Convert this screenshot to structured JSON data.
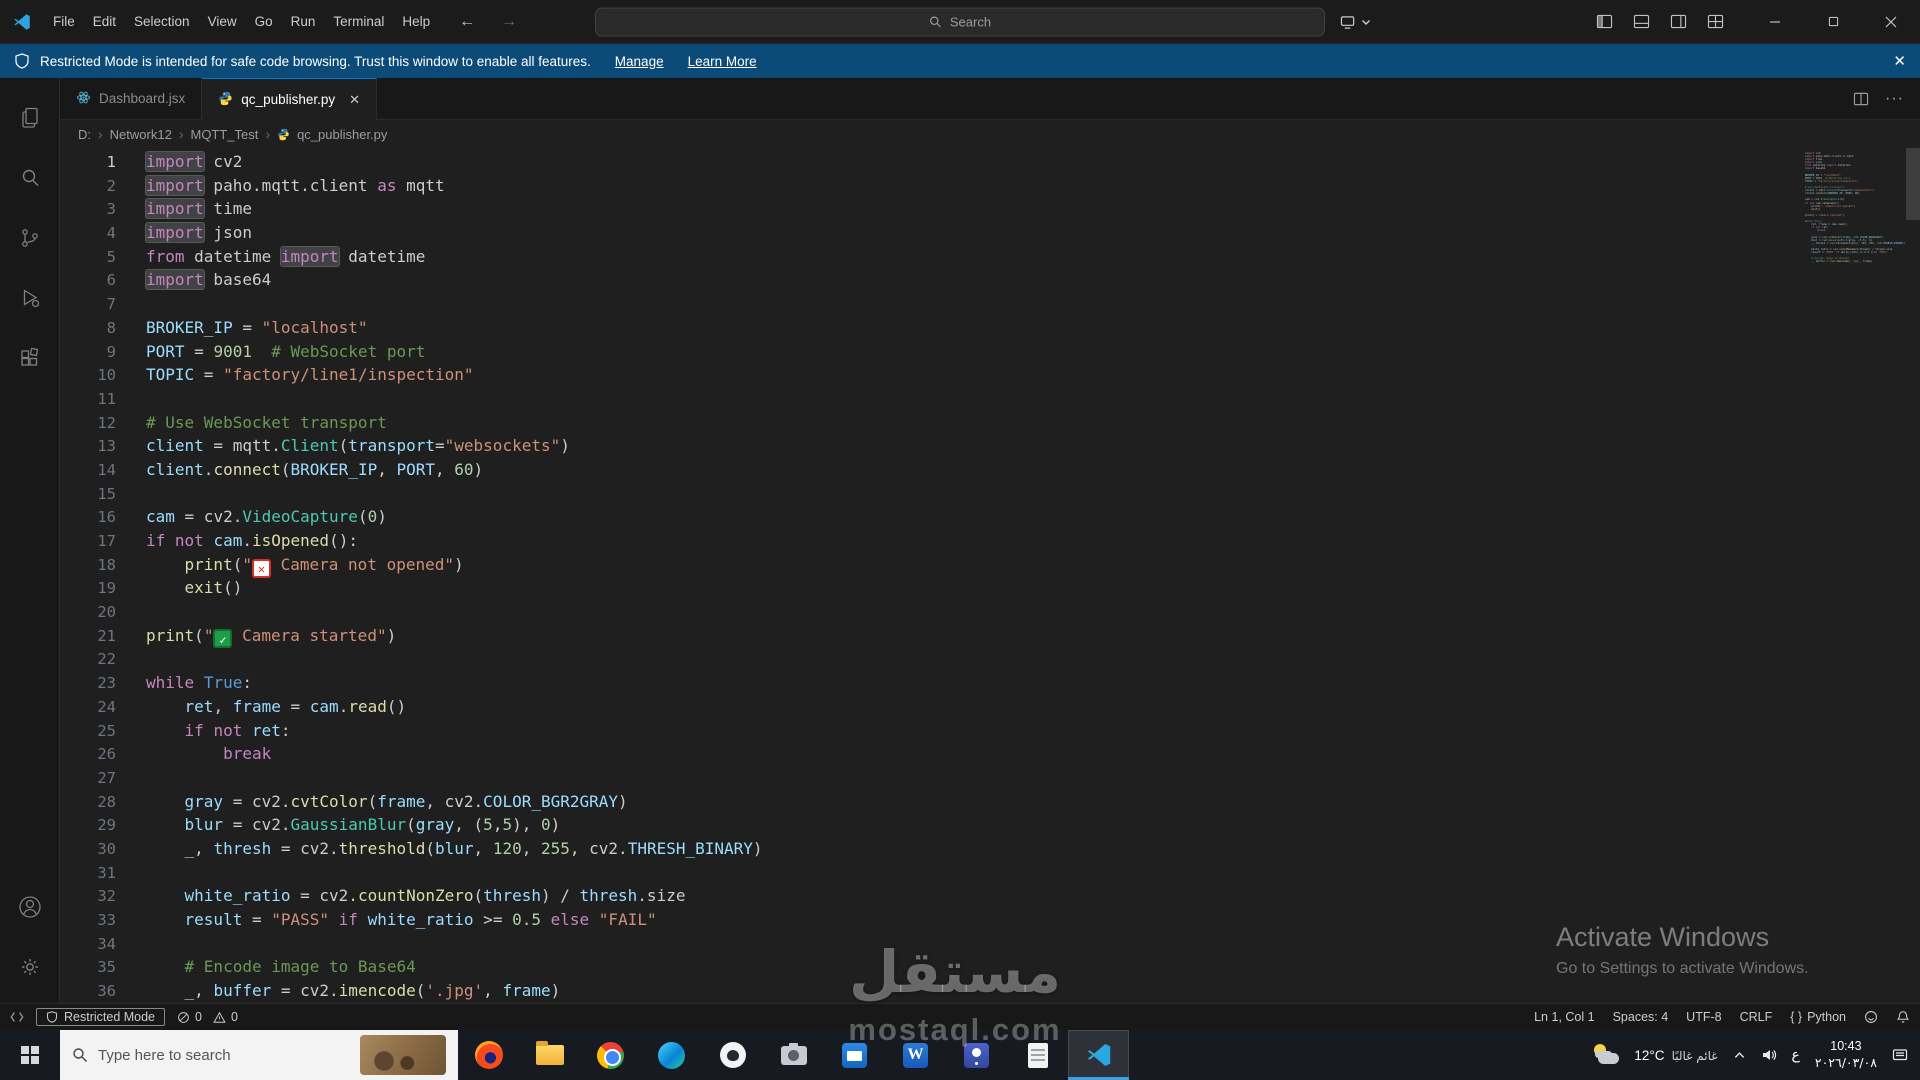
{
  "titlebar": {
    "menus": [
      "File",
      "Edit",
      "Selection",
      "View",
      "Go",
      "Run",
      "Terminal",
      "Help"
    ],
    "back_arrow": "←",
    "forward_arrow": "→",
    "search_placeholder": "Search"
  },
  "banner": {
    "text": "Restricted Mode is intended for safe code browsing. Trust this window to enable all features.",
    "manage_label": "Manage",
    "learn_more_label": "Learn More",
    "close_glyph": "✕"
  },
  "editor_tabs": [
    {
      "id": "dashboard",
      "label": "Dashboard.jsx",
      "icon": "react-icon",
      "active": false,
      "closable": false
    },
    {
      "id": "qc-publisher",
      "label": "qc_publisher.py",
      "icon": "python-icon",
      "active": true,
      "closable": true
    }
  ],
  "breadcrumbs": {
    "items": [
      "D:",
      "Network12",
      "MQTT_Test",
      "qc_publisher.py"
    ]
  },
  "editor": {
    "language": "python",
    "lines": [
      [
        [
          "khl",
          "import"
        ],
        [
          "d",
          " cv2"
        ]
      ],
      [
        [
          "khl",
          "import"
        ],
        [
          "d",
          " paho.mqtt.client "
        ],
        [
          "k",
          "as"
        ],
        [
          "d",
          " mqtt"
        ]
      ],
      [
        [
          "khl",
          "import"
        ],
        [
          "d",
          " time"
        ]
      ],
      [
        [
          "khl",
          "import"
        ],
        [
          "d",
          " json"
        ]
      ],
      [
        [
          "k",
          "from"
        ],
        [
          "d",
          " datetime "
        ],
        [
          "khl",
          "import"
        ],
        [
          "d",
          " datetime"
        ]
      ],
      [
        [
          "khl",
          "import"
        ],
        [
          "d",
          " base64"
        ]
      ],
      [],
      [
        [
          "v",
          "BROKER_IP"
        ],
        [
          "d",
          " = "
        ],
        [
          "s",
          "\"localhost\""
        ]
      ],
      [
        [
          "v",
          "PORT"
        ],
        [
          "d",
          " = "
        ],
        [
          "n",
          "9001"
        ],
        [
          "d",
          "  "
        ],
        [
          "c",
          "# WebSocket port"
        ]
      ],
      [
        [
          "v",
          "TOPIC"
        ],
        [
          "d",
          " = "
        ],
        [
          "s",
          "\"factory/line1/inspection\""
        ]
      ],
      [],
      [
        [
          "c",
          "# Use WebSocket transport"
        ]
      ],
      [
        [
          "v",
          "client"
        ],
        [
          "d",
          " = mqtt."
        ],
        [
          "t",
          "Client"
        ],
        [
          "d",
          "("
        ],
        [
          "pm",
          "transport"
        ],
        [
          "d",
          "="
        ],
        [
          "s",
          "\"websockets\""
        ],
        [
          "d",
          ")"
        ]
      ],
      [
        [
          "v",
          "client"
        ],
        [
          "d",
          "."
        ],
        [
          "f",
          "connect"
        ],
        [
          "d",
          "("
        ],
        [
          "v",
          "BROKER_IP"
        ],
        [
          "d",
          ", "
        ],
        [
          "v",
          "PORT"
        ],
        [
          "d",
          ", "
        ],
        [
          "n",
          "60"
        ],
        [
          "d",
          ")"
        ]
      ],
      [],
      [
        [
          "v",
          "cam"
        ],
        [
          "d",
          " = cv2."
        ],
        [
          "t",
          "VideoCapture"
        ],
        [
          "d",
          "("
        ],
        [
          "n",
          "0"
        ],
        [
          "d",
          ")"
        ]
      ],
      [
        [
          "k",
          "if"
        ],
        [
          "d",
          " "
        ],
        [
          "k",
          "not"
        ],
        [
          "d",
          " "
        ],
        [
          "v",
          "cam"
        ],
        [
          "d",
          "."
        ],
        [
          "f",
          "isOpened"
        ],
        [
          "d",
          "():"
        ]
      ],
      [
        [
          "d",
          "    "
        ],
        [
          "f",
          "print"
        ],
        [
          "d",
          "("
        ],
        [
          "s",
          "\""
        ],
        [
          "ex",
          "✕"
        ],
        [
          "s",
          " Camera not opened\""
        ],
        [
          "d",
          ")"
        ]
      ],
      [
        [
          "d",
          "    "
        ],
        [
          "f",
          "exit"
        ],
        [
          "d",
          "()"
        ]
      ],
      [],
      [
        [
          "f",
          "print"
        ],
        [
          "d",
          "("
        ],
        [
          "s",
          "\""
        ],
        [
          "chk",
          "✓"
        ],
        [
          "s",
          " Camera started\""
        ],
        [
          "d",
          ")"
        ]
      ],
      [],
      [
        [
          "k",
          "while"
        ],
        [
          "d",
          " "
        ],
        [
          "b",
          "True"
        ],
        [
          "d",
          ":"
        ]
      ],
      [
        [
          "d",
          "    "
        ],
        [
          "v",
          "ret"
        ],
        [
          "d",
          ", "
        ],
        [
          "v",
          "frame"
        ],
        [
          "d",
          " = "
        ],
        [
          "v",
          "cam"
        ],
        [
          "d",
          "."
        ],
        [
          "f",
          "read"
        ],
        [
          "d",
          "()"
        ]
      ],
      [
        [
          "d",
          "    "
        ],
        [
          "k",
          "if"
        ],
        [
          "d",
          " "
        ],
        [
          "k",
          "not"
        ],
        [
          "d",
          " "
        ],
        [
          "v",
          "ret"
        ],
        [
          "d",
          ":"
        ]
      ],
      [
        [
          "d",
          "        "
        ],
        [
          "k",
          "break"
        ]
      ],
      [],
      [
        [
          "d",
          "    "
        ],
        [
          "v",
          "gray"
        ],
        [
          "d",
          " = cv2."
        ],
        [
          "f",
          "cvtColor"
        ],
        [
          "d",
          "("
        ],
        [
          "v",
          "frame"
        ],
        [
          "d",
          ", cv2."
        ],
        [
          "v",
          "COLOR_BGR2GRAY"
        ],
        [
          "d",
          ")"
        ]
      ],
      [
        [
          "d",
          "    "
        ],
        [
          "v",
          "blur"
        ],
        [
          "d",
          " = cv2."
        ],
        [
          "t",
          "GaussianBlur"
        ],
        [
          "d",
          "("
        ],
        [
          "v",
          "gray"
        ],
        [
          "d",
          ", ("
        ],
        [
          "n",
          "5"
        ],
        [
          "d",
          ","
        ],
        [
          "n",
          "5"
        ],
        [
          "d",
          "), "
        ],
        [
          "n",
          "0"
        ],
        [
          "d",
          ")"
        ]
      ],
      [
        [
          "d",
          "    _, "
        ],
        [
          "v",
          "thresh"
        ],
        [
          "d",
          " = cv2."
        ],
        [
          "f",
          "threshold"
        ],
        [
          "d",
          "("
        ],
        [
          "v",
          "blur"
        ],
        [
          "d",
          ", "
        ],
        [
          "n",
          "120"
        ],
        [
          "d",
          ", "
        ],
        [
          "n",
          "255"
        ],
        [
          "d",
          ", cv2."
        ],
        [
          "v",
          "THRESH_BINARY"
        ],
        [
          "d",
          ")"
        ]
      ],
      [],
      [
        [
          "d",
          "    "
        ],
        [
          "v",
          "white_ratio"
        ],
        [
          "d",
          " = cv2."
        ],
        [
          "f",
          "countNonZero"
        ],
        [
          "d",
          "("
        ],
        [
          "v",
          "thresh"
        ],
        [
          "d",
          ") / "
        ],
        [
          "v",
          "thresh"
        ],
        [
          "d",
          ".size"
        ]
      ],
      [
        [
          "d",
          "    "
        ],
        [
          "v",
          "result"
        ],
        [
          "d",
          " = "
        ],
        [
          "s",
          "\"PASS\""
        ],
        [
          "d",
          " "
        ],
        [
          "k",
          "if"
        ],
        [
          "d",
          " "
        ],
        [
          "v",
          "white_ratio"
        ],
        [
          "d",
          " >= "
        ],
        [
          "n",
          "0.5"
        ],
        [
          "d",
          " "
        ],
        [
          "k",
          "else"
        ],
        [
          "d",
          " "
        ],
        [
          "s",
          "\"FAIL\""
        ]
      ],
      [],
      [
        [
          "d",
          "    "
        ],
        [
          "c",
          "# Encode image to Base64"
        ]
      ],
      [
        [
          "d",
          "    _, "
        ],
        [
          "v",
          "buffer"
        ],
        [
          "d",
          " = cv2."
        ],
        [
          "f",
          "imencode"
        ],
        [
          "d",
          "("
        ],
        [
          "s",
          "'.jpg'"
        ],
        [
          "d",
          ", "
        ],
        [
          "v",
          "frame"
        ],
        [
          "d",
          ")"
        ]
      ]
    ]
  },
  "statusbar": {
    "restricted_mode_label": "Restricted Mode",
    "errors": "0",
    "warnings": "0",
    "right_items": [
      {
        "id": "cursor-position",
        "label": "Ln 1, Col 1"
      },
      {
        "id": "indentation",
        "label": "Spaces: 4"
      },
      {
        "id": "encoding",
        "label": "UTF-8"
      },
      {
        "id": "eol",
        "label": "CRLF"
      },
      {
        "id": "language-mode",
        "icon_text": "{ }",
        "label": "Python"
      }
    ]
  },
  "taskbar": {
    "search_placeholder": "Type here to search",
    "apps": [
      {
        "id": "firefox",
        "active": false
      },
      {
        "id": "file-explorer",
        "active": false
      },
      {
        "id": "chrome",
        "active": false
      },
      {
        "id": "edge",
        "active": false
      },
      {
        "id": "github",
        "active": false
      },
      {
        "id": "camera",
        "active": false
      },
      {
        "id": "mail",
        "active": false
      },
      {
        "id": "word",
        "active": false
      },
      {
        "id": "teams",
        "active": false
      },
      {
        "id": "notepad",
        "active": false
      },
      {
        "id": "vscode",
        "active": true
      }
    ],
    "word_letter": "W",
    "tray": {
      "temperature": "12°C",
      "weather_condition": "غائم غالبًا",
      "language_indicator": "ع",
      "time": "10:43",
      "date": "٢٠٢٦/٠٣/٠٨"
    }
  },
  "watermarks": {
    "activate_line1": "Activate Windows",
    "activate_line2": "Go to Settings to activate Windows.",
    "site_name_arabic": "مستقل",
    "site_domain": "mostaql.com"
  },
  "colors": {
    "accent_blue": "#0078d4",
    "banner_blue": "#0c4a77",
    "keyword": "#C586C0",
    "string": "#CE9178",
    "comment": "#6A9955",
    "number": "#B5CEA8",
    "function": "#DCDCAA",
    "variable": "#9CDCFE",
    "class_name": "#4EC9B0"
  }
}
